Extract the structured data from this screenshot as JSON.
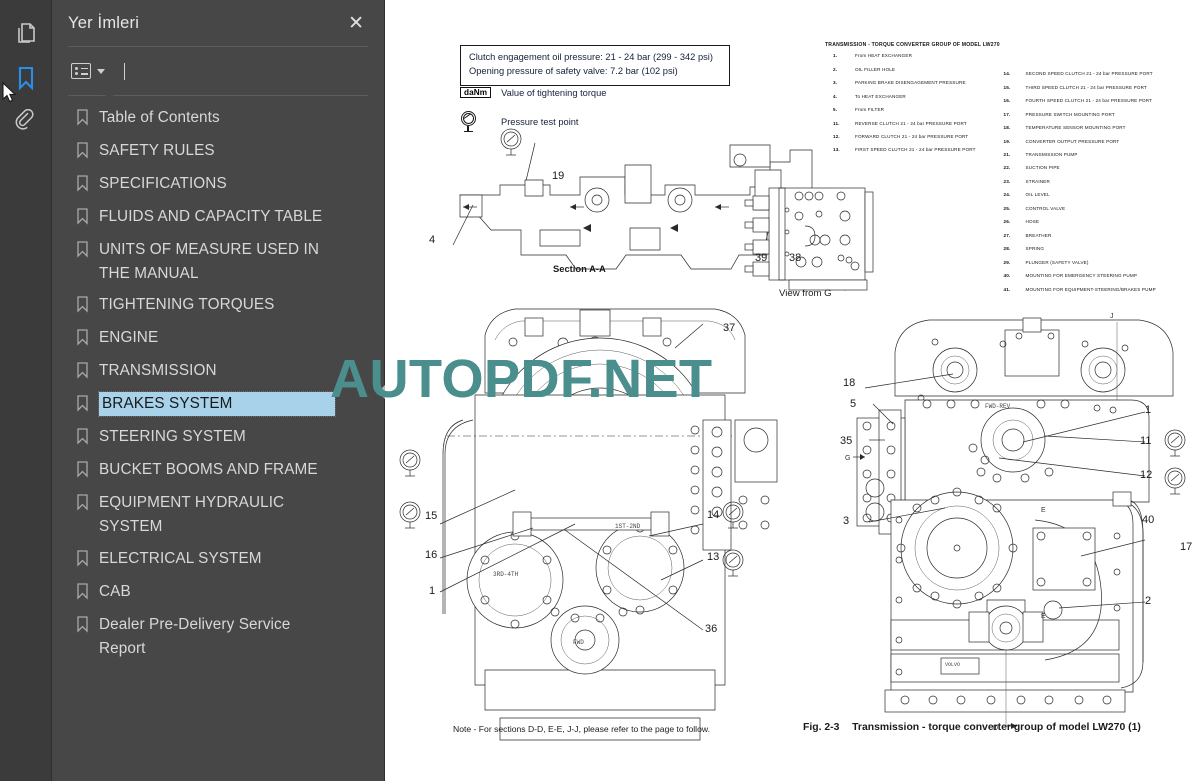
{
  "rail": {
    "items": [
      {
        "icon": "pages-thumbnail-icon",
        "name": "thumbnails",
        "active": false
      },
      {
        "icon": "bookmark-icon",
        "name": "bookmarks",
        "active": true
      },
      {
        "icon": "paperclip-attachment-icon",
        "name": "attachments",
        "active": false
      }
    ]
  },
  "panel": {
    "title": "Yer İmleri",
    "close_label": "✕",
    "toolbar": {
      "options_icon": "list-options-icon",
      "caret_icon": "chevron-down-icon"
    },
    "selected_index": 8,
    "items": [
      {
        "label": "Table of Contents"
      },
      {
        "label": "SAFETY RULES"
      },
      {
        "label": "SPECIFICATIONS"
      },
      {
        "label": "FLUIDS AND CAPACITY TABLE"
      },
      {
        "label": "UNITS OF MEASURE USED IN THE MANUAL"
      },
      {
        "label": "TIGHTENING TORQUES"
      },
      {
        "label": "ENGINE"
      },
      {
        "label": "TRANSMISSION"
      },
      {
        "label": "BRAKES SYSTEM"
      },
      {
        "label": "STEERING SYSTEM"
      },
      {
        "label": "BUCKET BOOMS AND FRAME"
      },
      {
        "label": "EQUIPMENT HYDRAULIC SYSTEM"
      },
      {
        "label": "ELECTRICAL SYSTEM"
      },
      {
        "label": "CAB"
      },
      {
        "label": "Dealer Pre-Delivery Service Report"
      }
    ]
  },
  "watermark": {
    "text": "AUTOPDF.NET",
    "color": "#4b8e8e"
  },
  "document": {
    "infobox": {
      "line1": "Clutch engagement oil pressure: 21 - 24 bar (299 - 342 psi)",
      "line2": "Opening pressure of safety valve: 7.2 bar (102 psi)"
    },
    "key_torque": {
      "badge": "daNm",
      "text": "Value of tightening torque"
    },
    "key_pressure": {
      "icon": "pressure-gauge-icon",
      "text": "Pressure test point"
    },
    "legend_title": "TRANSMISSION - TORQUE CONVERTER GROUP OF MODEL LW270",
    "legend_left": [
      {
        "num": "1.",
        "text": "From HEAT EXCHANGER"
      },
      {
        "num": "2.",
        "text": "OIL FILLER HOLE"
      },
      {
        "num": "3.",
        "text": "PARKING BRAKE DISENGAGEMENT PRESSURE"
      },
      {
        "num": "4.",
        "text": "To HEAT EXCHANGER"
      },
      {
        "num": "5.",
        "text": "From FILTER"
      },
      {
        "num": "11.",
        "text": "REVERSE CLUTCH 21 - 24 bar PRESSURE PORT"
      },
      {
        "num": "12.",
        "text": "FORWARD CLUTCH 21 - 24 bar PRESSURE PORT"
      },
      {
        "num": "13.",
        "text": "FIRST SPEED CLUTCH 21 - 24 bar PRESSURE PORT"
      }
    ],
    "legend_right": [
      {
        "num": "14.",
        "text": "SECOND SPEED CLUTCH 21 - 24 bar PRESSURE PORT"
      },
      {
        "num": "15.",
        "text": "THIRD SPEED CLUTCH 21 - 24 bar PRESSURE PORT"
      },
      {
        "num": "16.",
        "text": "FOURTH SPEED CLUTCH 21 - 24 bar PRESSURE PORT"
      },
      {
        "num": "17.",
        "text": "PRESSURE SWITCH MOUNTING PORT"
      },
      {
        "num": "18.",
        "text": "TEMPERATURE SENSOR MOUNTING PORT"
      },
      {
        "num": "19.",
        "text": "CONVERTER OUTPUT PRESSURE PORT"
      },
      {
        "num": "21.",
        "text": "TRANSMISSION PUMP"
      },
      {
        "num": "22.",
        "text": "SUCTION PIPE"
      },
      {
        "num": "23.",
        "text": "STRAINER"
      },
      {
        "num": "24.",
        "text": "OIL LEVEL"
      },
      {
        "num": "25.",
        "text": "CONTROL VALVE"
      },
      {
        "num": "26.",
        "text": "HOSE"
      },
      {
        "num": "27.",
        "text": "BREATHER"
      },
      {
        "num": "28.",
        "text": "SPRING"
      },
      {
        "num": "29.",
        "text": "PLUNGER (SAFETY VALVE)"
      },
      {
        "num": "40.",
        "text": "MOUNTING FOR EMERGENCY STEERING PUMP"
      },
      {
        "num": "41.",
        "text": "MOUNTING FOR EQUIPMENT-STEERING/BRAKES PUMP"
      }
    ],
    "section_aa_label": "Section A-A",
    "section_aa_callouts": [
      "19",
      "4",
      "39",
      "38"
    ],
    "view_g_label": "View from G",
    "main_callouts": [
      "37",
      "15",
      "16",
      "1",
      "14",
      "13",
      "36"
    ],
    "right_callouts": [
      "18",
      "5",
      "35",
      "3",
      "1",
      "11",
      "12",
      "40",
      "2",
      "17"
    ],
    "note": "Note - For sections D-D, E-E, J-J, please refer to the page to follow.",
    "fig_number": "Fig. 2-3",
    "fig_caption": "Transmission - torque converter group of model LW270 (1)"
  }
}
